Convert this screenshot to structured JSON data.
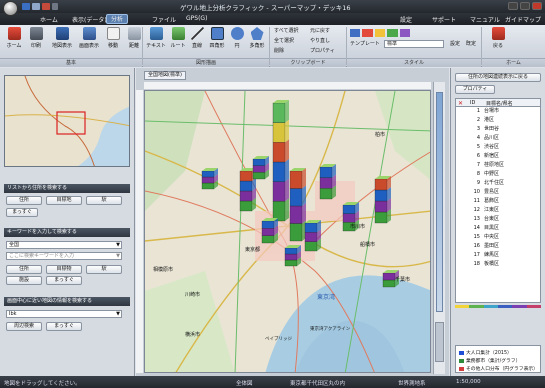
{
  "title": "ゲワル地上分析クラフィック - スーパーマップ・デッキ16",
  "menu": {
    "items": [
      "ホーム",
      "表示(データ)",
      "分析",
      "ファイル",
      "GPS(G)"
    ],
    "active_index": 2,
    "help_links": [
      "設定",
      "サポート",
      "マニュアル",
      "ガイドマップ"
    ]
  },
  "ribbon": {
    "buttons": [
      {
        "label": "ホーム",
        "icon": "home-icon"
      },
      {
        "label": "印刷",
        "icon": "printer-icon"
      },
      {
        "label": "地図表示",
        "icon": "map-view-icon"
      },
      {
        "label": "画面表示",
        "icon": "screen-icon"
      },
      {
        "label": "移動",
        "icon": "hand-icon"
      },
      {
        "label": "距離",
        "icon": "ruler-icon"
      },
      {
        "label": "テキスト",
        "icon": "text-icon"
      },
      {
        "label": "ルート",
        "icon": "route-icon"
      },
      {
        "label": "直線",
        "icon": "line-icon"
      },
      {
        "label": "四角形",
        "icon": "rectangle-icon"
      },
      {
        "label": "円",
        "icon": "circle-icon"
      },
      {
        "label": "多角形",
        "icon": "polygon-icon"
      }
    ],
    "small_buttons": [
      "すべて選択",
      "元に戻す",
      "全て選択",
      "やり直し",
      "削除",
      "プロパティ"
    ],
    "template_label": "テンプレート",
    "template_value": "標準",
    "set_label": "設定",
    "default_label": "既定",
    "back_label": "戻る",
    "groups": [
      "基本",
      "図形描画",
      "クリップボード",
      "スタイル",
      "ホーム"
    ]
  },
  "left": {
    "sec1": "リストから住所を検索する",
    "buttons1": [
      "住所",
      "目標地",
      "駅"
    ],
    "more1": "まっすぐ",
    "sec2": "キーワードを入力して検索する",
    "select_category": "全国",
    "keyword_placeholder": "ここに検索キーワードを入力",
    "buttons2": [
      "住所",
      "目標物",
      "駅"
    ],
    "buttons2b": [
      "施設",
      "まっすぐ"
    ],
    "sec3": "画面中心に近い地図の情報を検索する",
    "select_3": "Ibk",
    "buttons3": [
      "周辺検索",
      "まっすぐ"
    ]
  },
  "map_tab": "全国地図(標準)",
  "map_labels": [
    "東京湾",
    "東京都",
    "船橋市",
    "柏市",
    "横浜市",
    "川崎市",
    "千葉市",
    "市川市",
    "相模原市",
    "東京湾アクアライン",
    "ベイブリッジ"
  ],
  "right": {
    "top_button": "住所の地図連続表示に戻る",
    "top_button2": "プロパティ",
    "head": [
      "ID",
      "目標名/県名"
    ],
    "rows": [
      {
        "n": "1",
        "label": "台場市"
      },
      {
        "n": "2",
        "label": "港区"
      },
      {
        "n": "3",
        "label": "世田谷"
      },
      {
        "n": "4",
        "label": "品川区"
      },
      {
        "n": "5",
        "label": "渋谷区"
      },
      {
        "n": "6",
        "label": "新宿区"
      },
      {
        "n": "7",
        "label": "荏原地区"
      },
      {
        "n": "8",
        "label": "中野区"
      },
      {
        "n": "9",
        "label": "北千住区"
      },
      {
        "n": "10",
        "label": "豊島区"
      },
      {
        "n": "11",
        "label": "葛飾区"
      },
      {
        "n": "12",
        "label": "江東区"
      },
      {
        "n": "13",
        "label": "台東区"
      },
      {
        "n": "14",
        "label": "目黒区"
      },
      {
        "n": "15",
        "label": "中央区"
      },
      {
        "n": "16",
        "label": "墨田区"
      },
      {
        "n": "17",
        "label": "練馬区"
      },
      {
        "n": "18",
        "label": "板橋区"
      }
    ],
    "legend": [
      "大人口集計（2015）",
      "業務都市（集計/グラフ）",
      "その他人口分布（円グラフ表示）"
    ],
    "legend_colors": [
      "#1f4fd6",
      "#2e8b3a",
      "#d43d3d"
    ]
  },
  "status": {
    "left": "地図をドラッグしてください。",
    "scale_label": "全体図",
    "location": "東京都千代田区丸の内",
    "coord_label": "世界測地系",
    "scale": "1:50,000"
  },
  "chart_colors": [
    "#3a9c3a",
    "#7a2f9c",
    "#1f5fbf",
    "#c94b2c",
    "#d8c43a",
    "#5bb75b"
  ]
}
